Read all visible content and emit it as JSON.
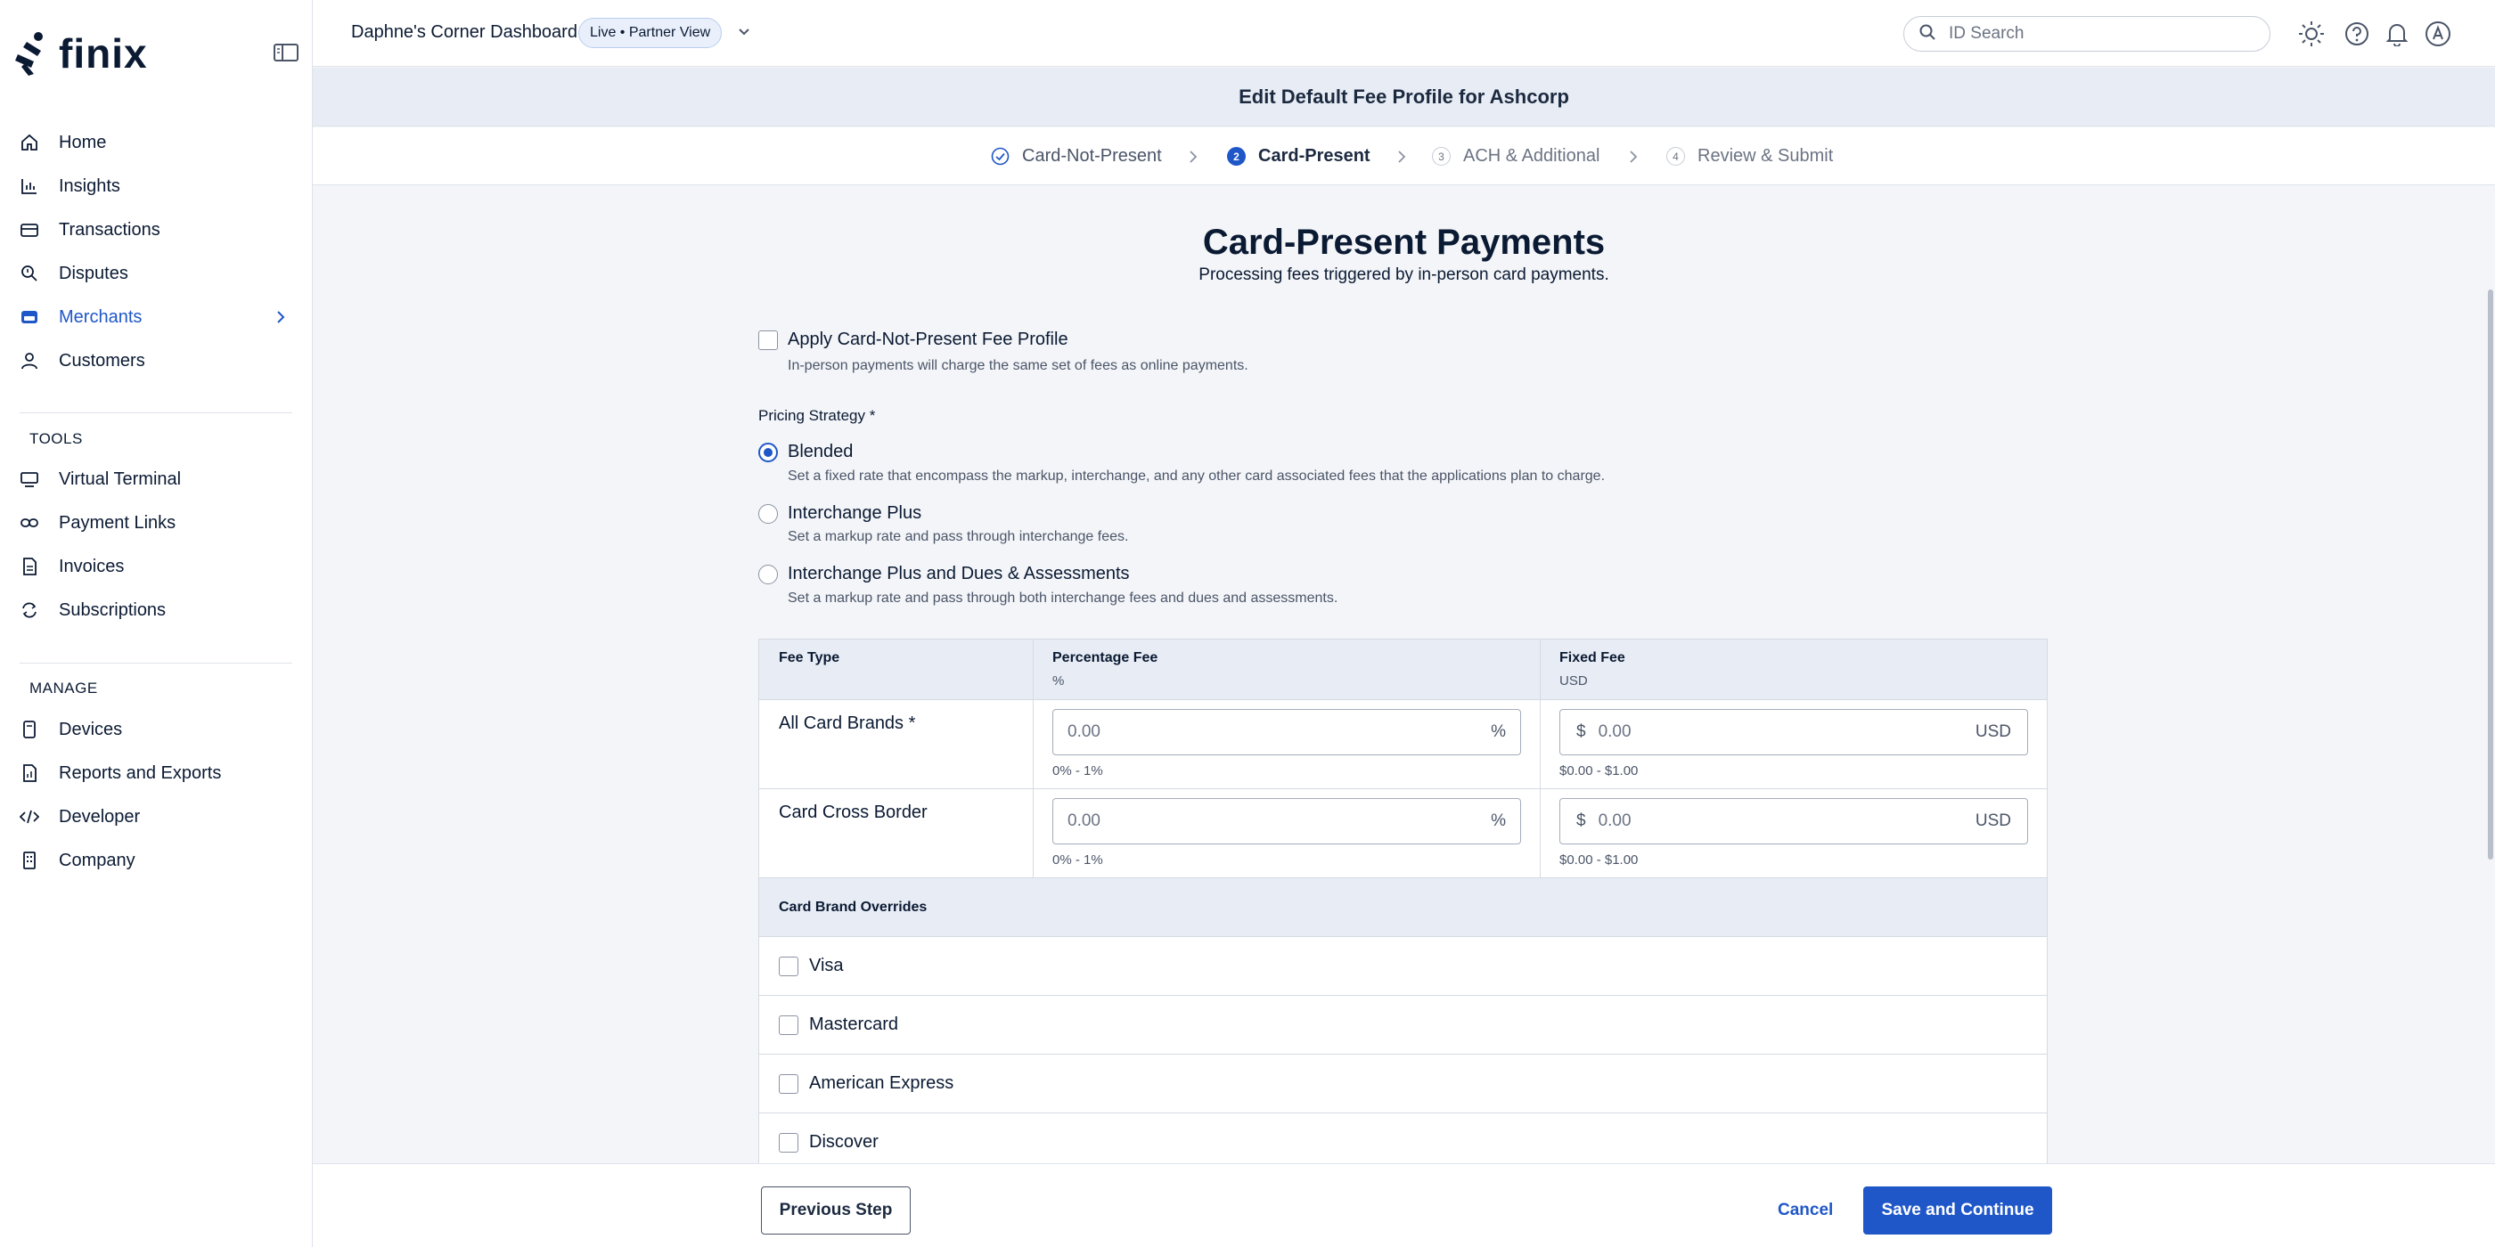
{
  "brand": {
    "name": "finix"
  },
  "sidebar": {
    "main_items": [
      {
        "label": "Home",
        "icon": "home-icon"
      },
      {
        "label": "Insights",
        "icon": "chart-icon"
      },
      {
        "label": "Transactions",
        "icon": "card-icon"
      },
      {
        "label": "Disputes",
        "icon": "magnifier-icon"
      },
      {
        "label": "Merchants",
        "icon": "store-icon",
        "active": true
      },
      {
        "label": "Customers",
        "icon": "person-icon"
      }
    ],
    "tools_title": "TOOLS",
    "tools_items": [
      {
        "label": "Virtual Terminal",
        "icon": "terminal-icon"
      },
      {
        "label": "Payment Links",
        "icon": "link-icon"
      },
      {
        "label": "Invoices",
        "icon": "invoice-icon"
      },
      {
        "label": "Subscriptions",
        "icon": "refresh-icon"
      }
    ],
    "manage_title": "MANAGE",
    "manage_items": [
      {
        "label": "Devices",
        "icon": "device-icon"
      },
      {
        "label": "Reports and Exports",
        "icon": "report-icon"
      },
      {
        "label": "Developer",
        "icon": "code-icon"
      },
      {
        "label": "Company",
        "icon": "building-icon"
      }
    ]
  },
  "topbar": {
    "dashboard_title": "Daphne's Corner Dashboard",
    "mode_badge": "Live • Partner View",
    "search_placeholder": "ID Search"
  },
  "page": {
    "title": "Edit Default Fee Profile for Ashcorp"
  },
  "stepper": {
    "steps": [
      {
        "number": "1",
        "label": "Card-Not-Present",
        "state": "done"
      },
      {
        "number": "2",
        "label": "Card-Present",
        "state": "current"
      },
      {
        "number": "3",
        "label": "ACH & Additional",
        "state": "todo"
      },
      {
        "number": "4",
        "label": "Review & Submit",
        "state": "todo"
      }
    ]
  },
  "content": {
    "title": "Card-Present Payments",
    "subtitle": "Processing fees triggered by in-person card payments.",
    "apply_cnp": {
      "label": "Apply Card-Not-Present Fee Profile",
      "description": "In-person payments will charge the same set of fees as online payments.",
      "checked": false
    },
    "pricing_strategy": {
      "label": "Pricing Strategy *",
      "selected": "Blended",
      "options": [
        {
          "label": "Blended",
          "description": "Set a fixed rate that encompass the markup, interchange, and any other card associated fees that the applications plan to charge."
        },
        {
          "label": "Interchange Plus",
          "description": "Set a markup rate and pass through interchange fees."
        },
        {
          "label": "Interchange Plus and Dues & Assessments",
          "description": "Set a markup rate and pass through both interchange fees and dues and assessments."
        }
      ]
    },
    "fee_table": {
      "headers": {
        "fee_type": "Fee Type",
        "percentage": "Percentage Fee",
        "percentage_unit": "%",
        "fixed": "Fixed Fee",
        "fixed_unit": "USD"
      },
      "rows": [
        {
          "label": "All Card Brands *",
          "percent_placeholder": "0.00",
          "percent_suffix": "%",
          "percent_hint": "0% - 1%",
          "fixed_prefix": "$",
          "fixed_placeholder": "0.00",
          "fixed_suffix": "USD",
          "fixed_hint": "$0.00 - $1.00"
        },
        {
          "label": "Card Cross Border",
          "percent_placeholder": "0.00",
          "percent_suffix": "%",
          "percent_hint": "0% - 1%",
          "fixed_prefix": "$",
          "fixed_placeholder": "0.00",
          "fixed_suffix": "USD",
          "fixed_hint": "$0.00 - $1.00"
        }
      ],
      "overrides_title": "Card Brand Overrides",
      "overrides": [
        {
          "label": "Visa",
          "checked": false
        },
        {
          "label": "Mastercard",
          "checked": false
        },
        {
          "label": "American Express",
          "checked": false
        },
        {
          "label": "Discover",
          "checked": false
        }
      ]
    }
  },
  "footer": {
    "previous_label": "Previous Step",
    "cancel_label": "Cancel",
    "save_label": "Save and Continue"
  },
  "colors": {
    "accent": "#1f57c8",
    "text": "#0b1a33",
    "panel": "#e8edf5",
    "background": "#f3f5f8"
  }
}
